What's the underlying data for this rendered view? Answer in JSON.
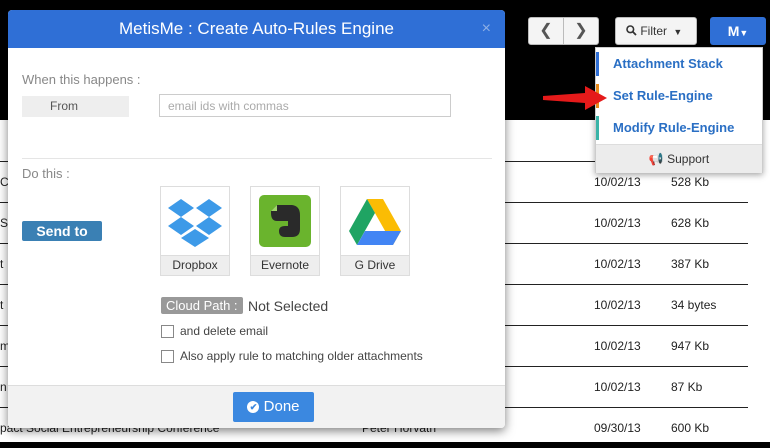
{
  "top_nav": {
    "prev": "❮",
    "next": "❯",
    "filter_label": "Filter",
    "menu_label": "M"
  },
  "dropdown": {
    "items": [
      "Attachment Stack",
      "Set Rule-Engine",
      "Modify Rule-Engine"
    ],
    "bar_colors": [
      "#2f6fd6",
      "#e88a1a",
      "#3ab4a8"
    ],
    "support_label": "Support"
  },
  "table_rows": [
    {
      "title": "C",
      "author": "",
      "date": "10/02/13",
      "size": "528 Kb"
    },
    {
      "title": "S",
      "author": "",
      "date": "10/02/13",
      "size": "628 Kb"
    },
    {
      "title": "t",
      "author": "",
      "date": "10/02/13",
      "size": "387 Kb"
    },
    {
      "title": "t",
      "author": "",
      "date": "10/02/13",
      "size": "34 bytes"
    },
    {
      "title": "m",
      "author": "",
      "date": "10/02/13",
      "size": "947 Kb"
    },
    {
      "title": "n",
      "author": "",
      "date": "10/02/13",
      "size": "87 Kb"
    },
    {
      "title": "pact Social Entrepreneurship Conference",
      "author": "Peter Horvath",
      "date": "09/30/13",
      "size": "600 Kb"
    }
  ],
  "modal": {
    "title": "MetisMe : Create Auto-Rules Engine",
    "close": "×",
    "when_label": "When this happens :",
    "from_label": "From",
    "email_placeholder": "email ids with commas",
    "do_label": "Do this :",
    "send_to_label": "Send to",
    "destinations": [
      "Dropbox",
      "Evernote",
      "G Drive"
    ],
    "cloud_path_label": "Cloud Path :",
    "cloud_path_value": "Not Selected",
    "delete_email_label": "and delete email",
    "apply_older_label": "Also apply rule to matching older attachments",
    "done_label": "Done"
  }
}
